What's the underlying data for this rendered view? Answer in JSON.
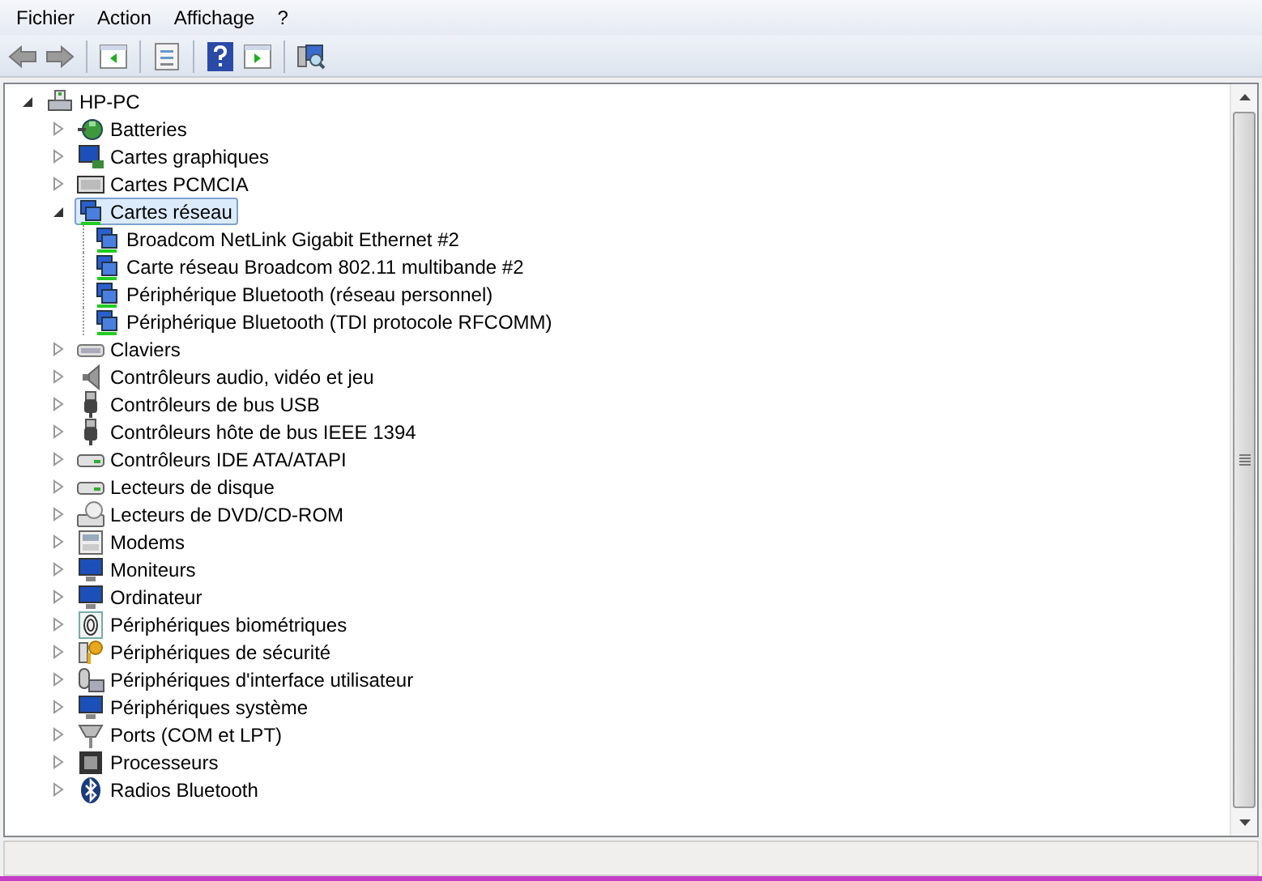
{
  "menu": [
    "Fichier",
    "Action",
    "Affichage",
    "?"
  ],
  "toolbar": [
    {
      "kind": "back"
    },
    {
      "kind": "forward"
    },
    {
      "kind": "sep"
    },
    {
      "kind": "tree-pane"
    },
    {
      "kind": "sep"
    },
    {
      "kind": "properties"
    },
    {
      "kind": "sep"
    },
    {
      "kind": "help"
    },
    {
      "kind": "action-pane"
    },
    {
      "kind": "sep"
    },
    {
      "kind": "scan"
    }
  ],
  "tree": {
    "label": "HP-PC",
    "kind": "computer",
    "expanded": true,
    "selected": false,
    "children": [
      {
        "label": "Batteries",
        "kind": "battery",
        "expanded": false,
        "selected": false
      },
      {
        "label": "Cartes graphiques",
        "kind": "display",
        "expanded": false,
        "selected": false
      },
      {
        "label": "Cartes PCMCIA",
        "kind": "pcmcia",
        "expanded": false,
        "selected": false
      },
      {
        "label": "Cartes réseau",
        "kind": "network",
        "expanded": true,
        "selected": true,
        "children": [
          {
            "label": "Broadcom NetLink Gigabit Ethernet #2",
            "kind": "network",
            "selected": false
          },
          {
            "label": "Carte réseau Broadcom 802.11 multibande #2",
            "kind": "network",
            "selected": false
          },
          {
            "label": "Périphérique Bluetooth (réseau personnel)",
            "kind": "network",
            "selected": false
          },
          {
            "label": "Périphérique Bluetooth (TDI protocole RFCOMM)",
            "kind": "network",
            "selected": false
          }
        ]
      },
      {
        "label": "Claviers",
        "kind": "keyboard",
        "expanded": false,
        "selected": false
      },
      {
        "label": "Contrôleurs audio, vidéo et jeu",
        "kind": "speaker",
        "expanded": false,
        "selected": false
      },
      {
        "label": "Contrôleurs de bus USB",
        "kind": "plug",
        "expanded": false,
        "selected": false
      },
      {
        "label": "Contrôleurs hôte de bus IEEE 1394",
        "kind": "plug",
        "expanded": false,
        "selected": false
      },
      {
        "label": "Contrôleurs IDE ATA/ATAPI",
        "kind": "drive",
        "expanded": false,
        "selected": false
      },
      {
        "label": "Lecteurs de disque",
        "kind": "drive",
        "expanded": false,
        "selected": false
      },
      {
        "label": "Lecteurs de DVD/CD-ROM",
        "kind": "dvd",
        "expanded": false,
        "selected": false
      },
      {
        "label": "Modems",
        "kind": "modem",
        "expanded": false,
        "selected": false
      },
      {
        "label": "Moniteurs",
        "kind": "monitor",
        "expanded": false,
        "selected": false
      },
      {
        "label": "Ordinateur",
        "kind": "monitor",
        "expanded": false,
        "selected": false
      },
      {
        "label": "Périphériques biométriques",
        "kind": "fingerprint",
        "expanded": false,
        "selected": false
      },
      {
        "label": "Périphériques de sécurité",
        "kind": "key",
        "expanded": false,
        "selected": false
      },
      {
        "label": "Périphériques d'interface utilisateur",
        "kind": "hid",
        "expanded": false,
        "selected": false
      },
      {
        "label": "Périphériques système",
        "kind": "monitor",
        "expanded": false,
        "selected": false
      },
      {
        "label": "Ports (COM et LPT)",
        "kind": "port",
        "expanded": false,
        "selected": false
      },
      {
        "label": "Processeurs",
        "kind": "chip",
        "expanded": false,
        "selected": false
      },
      {
        "label": "Radios Bluetooth",
        "kind": "bluetooth",
        "expanded": false,
        "selected": false
      }
    ]
  }
}
